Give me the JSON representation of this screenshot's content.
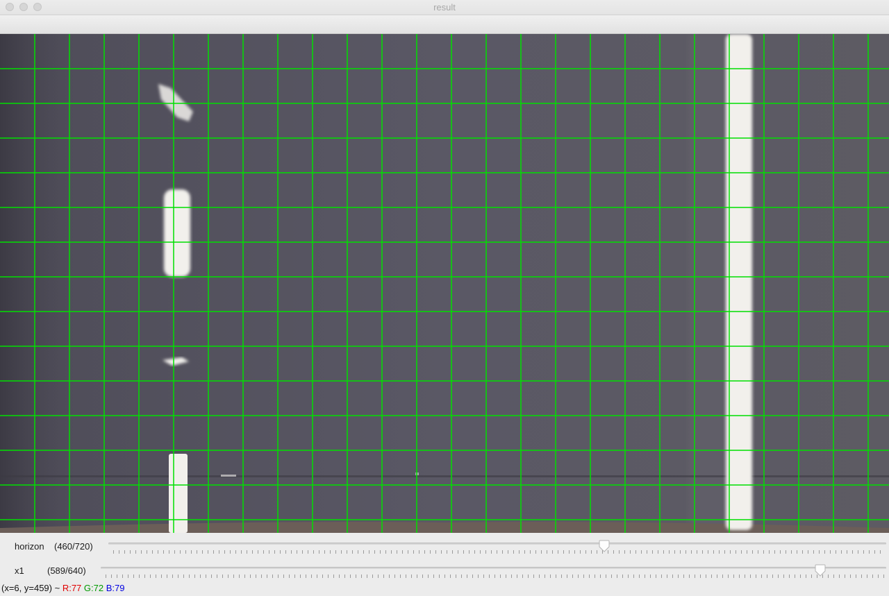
{
  "window": {
    "title": "result"
  },
  "trackbars": [
    {
      "name": "horizon",
      "value_text": "(460/720)",
      "value": 460,
      "max": 720
    },
    {
      "name": "x1",
      "value_text": "(589/640)",
      "value": 589,
      "max": 640
    }
  ],
  "status": {
    "coords": "(x=6, y=459) ~",
    "r": "R:77",
    "g": "G:72",
    "b": "B:79"
  },
  "colors": {
    "grid": "#00e000",
    "road": "#565461",
    "lane_marking": "#f2f0ec",
    "status_r": "#e00000",
    "status_g": "#009a00",
    "status_b": "#0000e0"
  }
}
